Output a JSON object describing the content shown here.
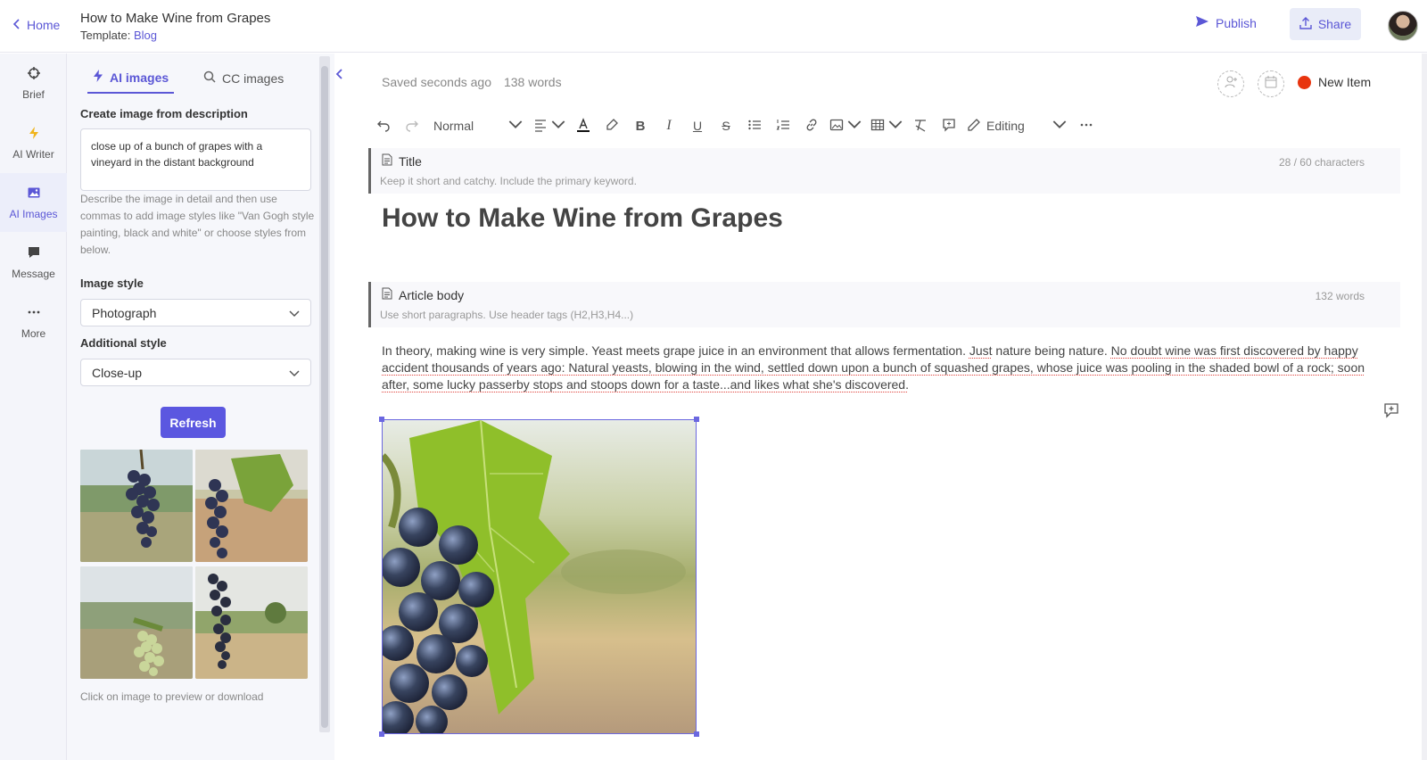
{
  "header": {
    "home_label": "Home",
    "doc_title": "How to Make Wine from Grapes",
    "template_prefix": "Template:",
    "template_name": "Blog",
    "publish_label": "Publish",
    "share_label": "Share",
    "avatar_icon": "user-avatar"
  },
  "leftnav": {
    "items": [
      {
        "label": "Brief",
        "icon": "crosshair-icon"
      },
      {
        "label": "AI Writer",
        "icon": "lightning-icon"
      },
      {
        "label": "AI Images",
        "icon": "image-icon"
      },
      {
        "label": "Message",
        "icon": "chat-icon"
      },
      {
        "label": "More",
        "icon": "ellipsis-icon"
      }
    ],
    "active": "AI Images"
  },
  "panel": {
    "tabs": [
      {
        "label": "AI images",
        "icon": "lightning-icon"
      },
      {
        "label": "CC images",
        "icon": "search-icon"
      }
    ],
    "create_label": "Create image from description",
    "description_value": "close up of a bunch of grapes with a vineyard in the distant background",
    "help_text": "Describe the image in detail and then use commas to add image styles like \"Van Gogh style painting, black and white\" or choose styles from below.",
    "image_style_label": "Image style",
    "image_style_value": "Photograph",
    "additional_style_label": "Additional style",
    "additional_style_value": "Close-up",
    "refresh_label": "Refresh",
    "hint_text": "Click on image to preview or download"
  },
  "editor": {
    "saved_text": "Saved seconds ago",
    "word_count": "138 words",
    "new_item_label": "New Item",
    "toolbar": {
      "paragraph_style": "Normal",
      "mode": "Editing"
    },
    "title_block": {
      "label": "Title",
      "hint": "Keep it short and catchy. Include the primary keyword.",
      "count": "28 / 60 characters"
    },
    "article_title": "How to Make Wine from Grapes",
    "body_block": {
      "label": "Article body",
      "hint": "Use short paragraphs. Use header tags (H2,H3,H4...)",
      "count": "132 words"
    },
    "body_text_plain": "In theory, making wine is very simple. Yeast meets grape juice in an environment that allows fermentation. ",
    "body_text_underlined_1": "Just",
    "body_text_plain_2": " nature being nature. ",
    "body_text_underlined_2": "No doubt wine was first discovered by happy accident thousands of years ago: Natural yeasts, blowing in the wind, settled down upon a bunch of squashed grapes, whose juice was pooling in the shaded bowl of a rock; soon after, some lucky passerby stops and stoops down for a taste...and likes what she's discovered."
  },
  "colors": {
    "accent": "#5b57d6",
    "button": "#5b57e0",
    "status_red": "#e8340e"
  }
}
